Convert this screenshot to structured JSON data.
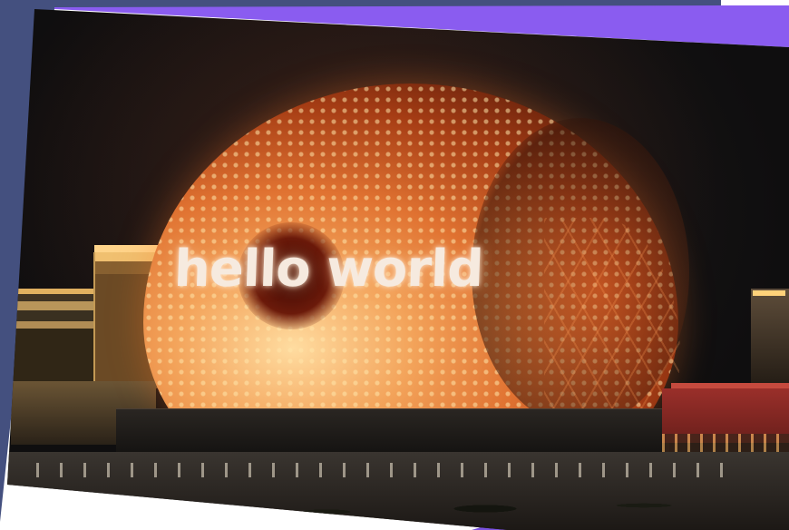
{
  "photo": {
    "display_text": "hello world"
  }
}
